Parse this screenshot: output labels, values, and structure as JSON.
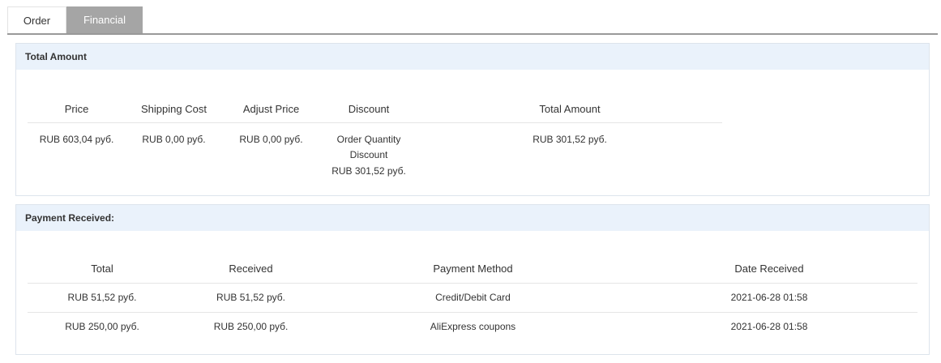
{
  "tabs": {
    "order": "Order",
    "financial": "Financial"
  },
  "total_amount": {
    "title": "Total Amount",
    "headers": {
      "price": "Price",
      "shipping": "Shipping Cost",
      "adjust": "Adjust Price",
      "discount": "Discount",
      "total": "Total Amount"
    },
    "row": {
      "price": "RUB 603,04 руб.",
      "shipping": "RUB 0,00 руб.",
      "adjust": "RUB 0,00 руб.",
      "discount_line1": "Order Quantity",
      "discount_line2": "Discount",
      "discount_line3": "RUB 301,52 руб.",
      "total": "RUB 301,52 руб."
    }
  },
  "payment": {
    "title": "Payment Received:",
    "headers": {
      "total": "Total",
      "received": "Received",
      "method": "Payment Method",
      "date": "Date Received"
    },
    "rows": [
      {
        "total": "RUB 51,52 руб.",
        "received": "RUB 51,52 руб.",
        "method": "Credit/Debit Card",
        "date": "2021-06-28 01:58"
      },
      {
        "total": "RUB 250,00 руб.",
        "received": "RUB 250,00 руб.",
        "method": "AliExpress coupons",
        "date": "2021-06-28 01:58"
      }
    ]
  }
}
